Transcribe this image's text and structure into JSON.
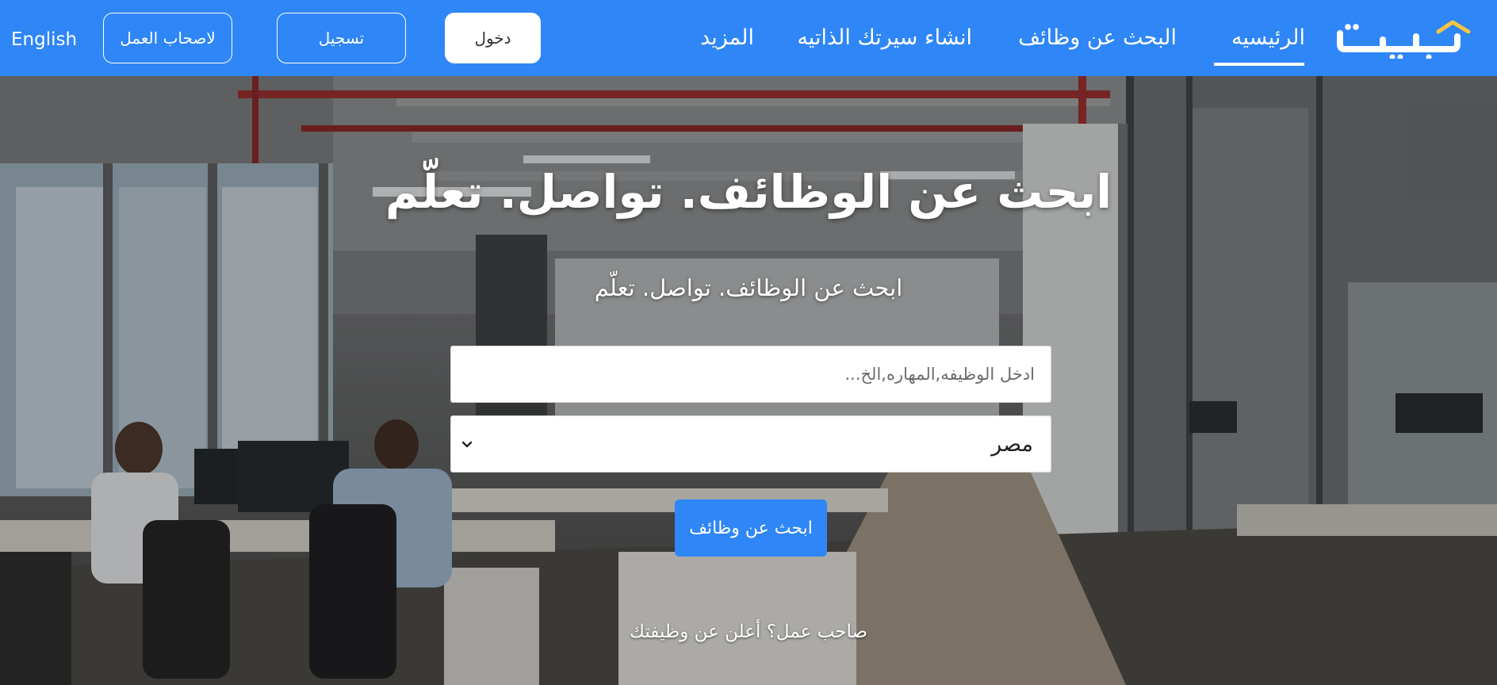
{
  "brand": {
    "logo_text": "بيت",
    "accent_color": "#f5c542"
  },
  "nav": {
    "home": "الرئيسيه",
    "find_jobs": "البحث عن وظائف",
    "create_cv": "انشاء سيرتك الذاتيه",
    "more": "المزيد"
  },
  "auth": {
    "login": "دخول",
    "register": "تسجيل",
    "employers": "لاصحاب العمل",
    "language": "English"
  },
  "hero": {
    "headline": "ابحث عن الوظائف. تواصل. تعلّم",
    "subheadline": "ابحث عن الوظائف. تواصل. تعلّم",
    "search_placeholder": "ادخل الوظيفه,المهاره,الخ...",
    "country_value": "مصر",
    "search_button": "ابحث عن وظائف",
    "employer_link": "صاحب عمل؟ أعلن عن وظيفتك"
  },
  "colors": {
    "primary": "#2f86f6",
    "text_on_primary": "#ffffff"
  }
}
